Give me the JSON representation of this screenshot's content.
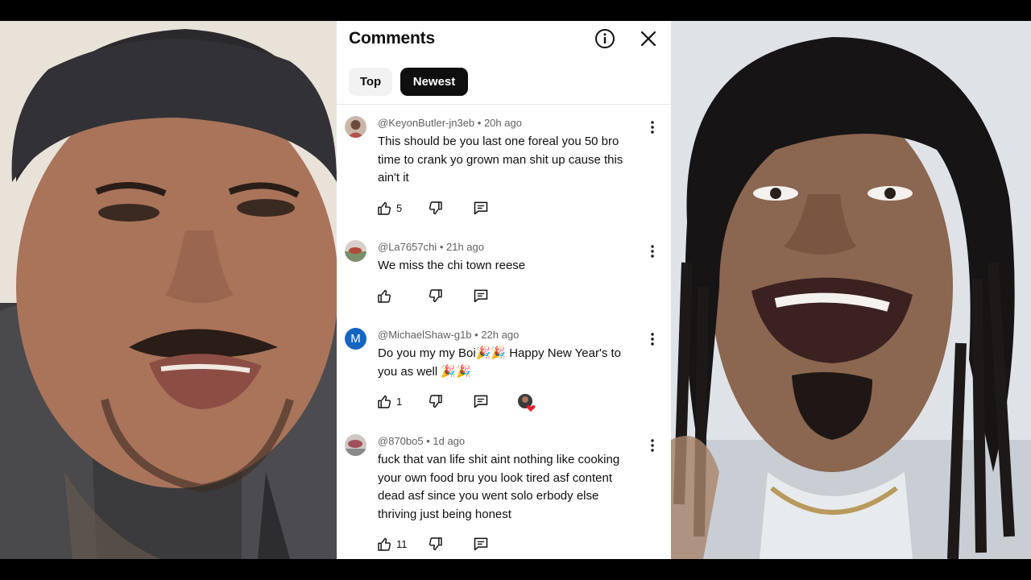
{
  "panel": {
    "title": "Comments",
    "info_icon": "info-icon",
    "close_icon": "close-icon",
    "chips": [
      {
        "label": "Top",
        "selected": false
      },
      {
        "label": "Newest",
        "selected": true
      }
    ]
  },
  "comments": [
    {
      "author": "@KeyonButler-jn3eb",
      "time": "20h ago",
      "lines": [
        "This should be you last one foreal you 50 bro",
        "time to crank yo grown man shit up cause this",
        "ain't it"
      ],
      "likes": "5",
      "avatar_color": "#b5524a"
    },
    {
      "author": "@La7657chi",
      "time": "21h ago",
      "lines": [
        "We miss the chi town reese"
      ],
      "likes": "",
      "avatar_color": "#7a8f6a"
    },
    {
      "author": "@MichaelShaw-g1b",
      "time": "22h ago",
      "lines": [
        "Do you my my Boi🎉🎉 Happy New Year's to",
        "you as well 🎉🎉"
      ],
      "likes": "1",
      "avatar_letter": "M",
      "avatar_color": "#1565c0",
      "creator_heart": true
    },
    {
      "author": "@870bo5",
      "time": "1d ago",
      "lines": [
        "fuck that van life shit aint nothing like cooking",
        "your own food bru you  look tired asf content",
        "dead asf since you went solo erbody else",
        "thriving just being honest"
      ],
      "likes": "11",
      "avatar_color": "#a0505a"
    }
  ],
  "icons": {
    "like": "thumbs-up-icon",
    "dislike": "thumbs-down-icon",
    "reply": "reply-icon",
    "more": "more-vert-icon"
  },
  "colors": {
    "selected_chip_bg": "#0f0f0f",
    "chip_bg": "#f2f2f2",
    "meta_text": "#606060",
    "heart": "#e5202a"
  }
}
